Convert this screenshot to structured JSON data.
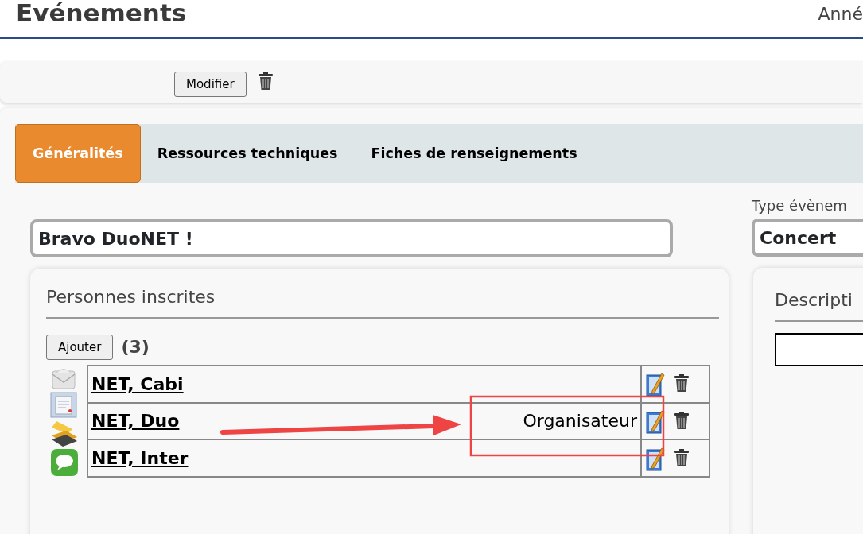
{
  "header": {
    "title": "Evénements",
    "year_label": "Anné"
  },
  "toolbar": {
    "button": "Modifier"
  },
  "tabs": [
    {
      "label": "Généralités",
      "selected": true
    },
    {
      "label": "Ressources techniques",
      "selected": false
    },
    {
      "label": "Fiches de renseignements",
      "selected": false
    }
  ],
  "event_name": "Bravo DuoNET !",
  "event_type": {
    "label": "Type évènem",
    "value": "Concert"
  },
  "registrants": {
    "title": "Personnes inscrites",
    "add_button": "Ajouter",
    "count": "(3)",
    "rows": [
      {
        "name": "NET, Cabi"
      },
      {
        "name": "NET, Duo",
        "role": "Organisateur"
      },
      {
        "name": "NET, Inter"
      }
    ]
  },
  "description": {
    "title": "Descripti"
  }
}
